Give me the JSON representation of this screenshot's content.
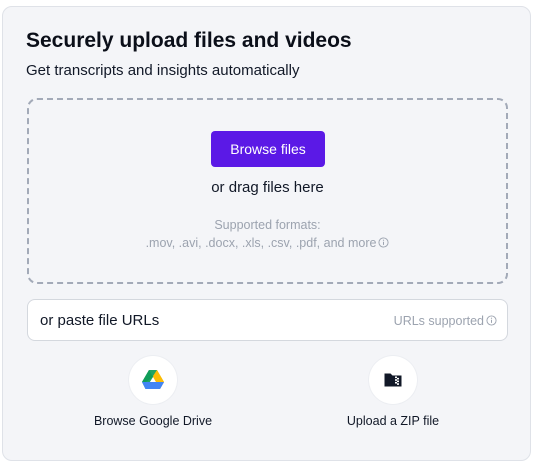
{
  "header": {
    "title": "Securely upload files and videos",
    "subtitle": "Get transcripts and insights automatically"
  },
  "dropzone": {
    "browse_label": "Browse files",
    "drag_text": "or drag files here",
    "formats_label": "Supported formats:",
    "formats_list": ".mov, .avi, .docx, .xls, .csv, .pdf, and more"
  },
  "url_field": {
    "placeholder": "or paste file URLs",
    "hint": "URLs supported"
  },
  "sources": [
    {
      "label": "Browse Google Drive",
      "icon": "google-drive-icon"
    },
    {
      "label": "Upload a ZIP file",
      "icon": "zip-file-icon"
    }
  ],
  "colors": {
    "primary": "#5b19e6",
    "card_bg": "#f4f5f8",
    "muted_text": "#9ca3af"
  }
}
